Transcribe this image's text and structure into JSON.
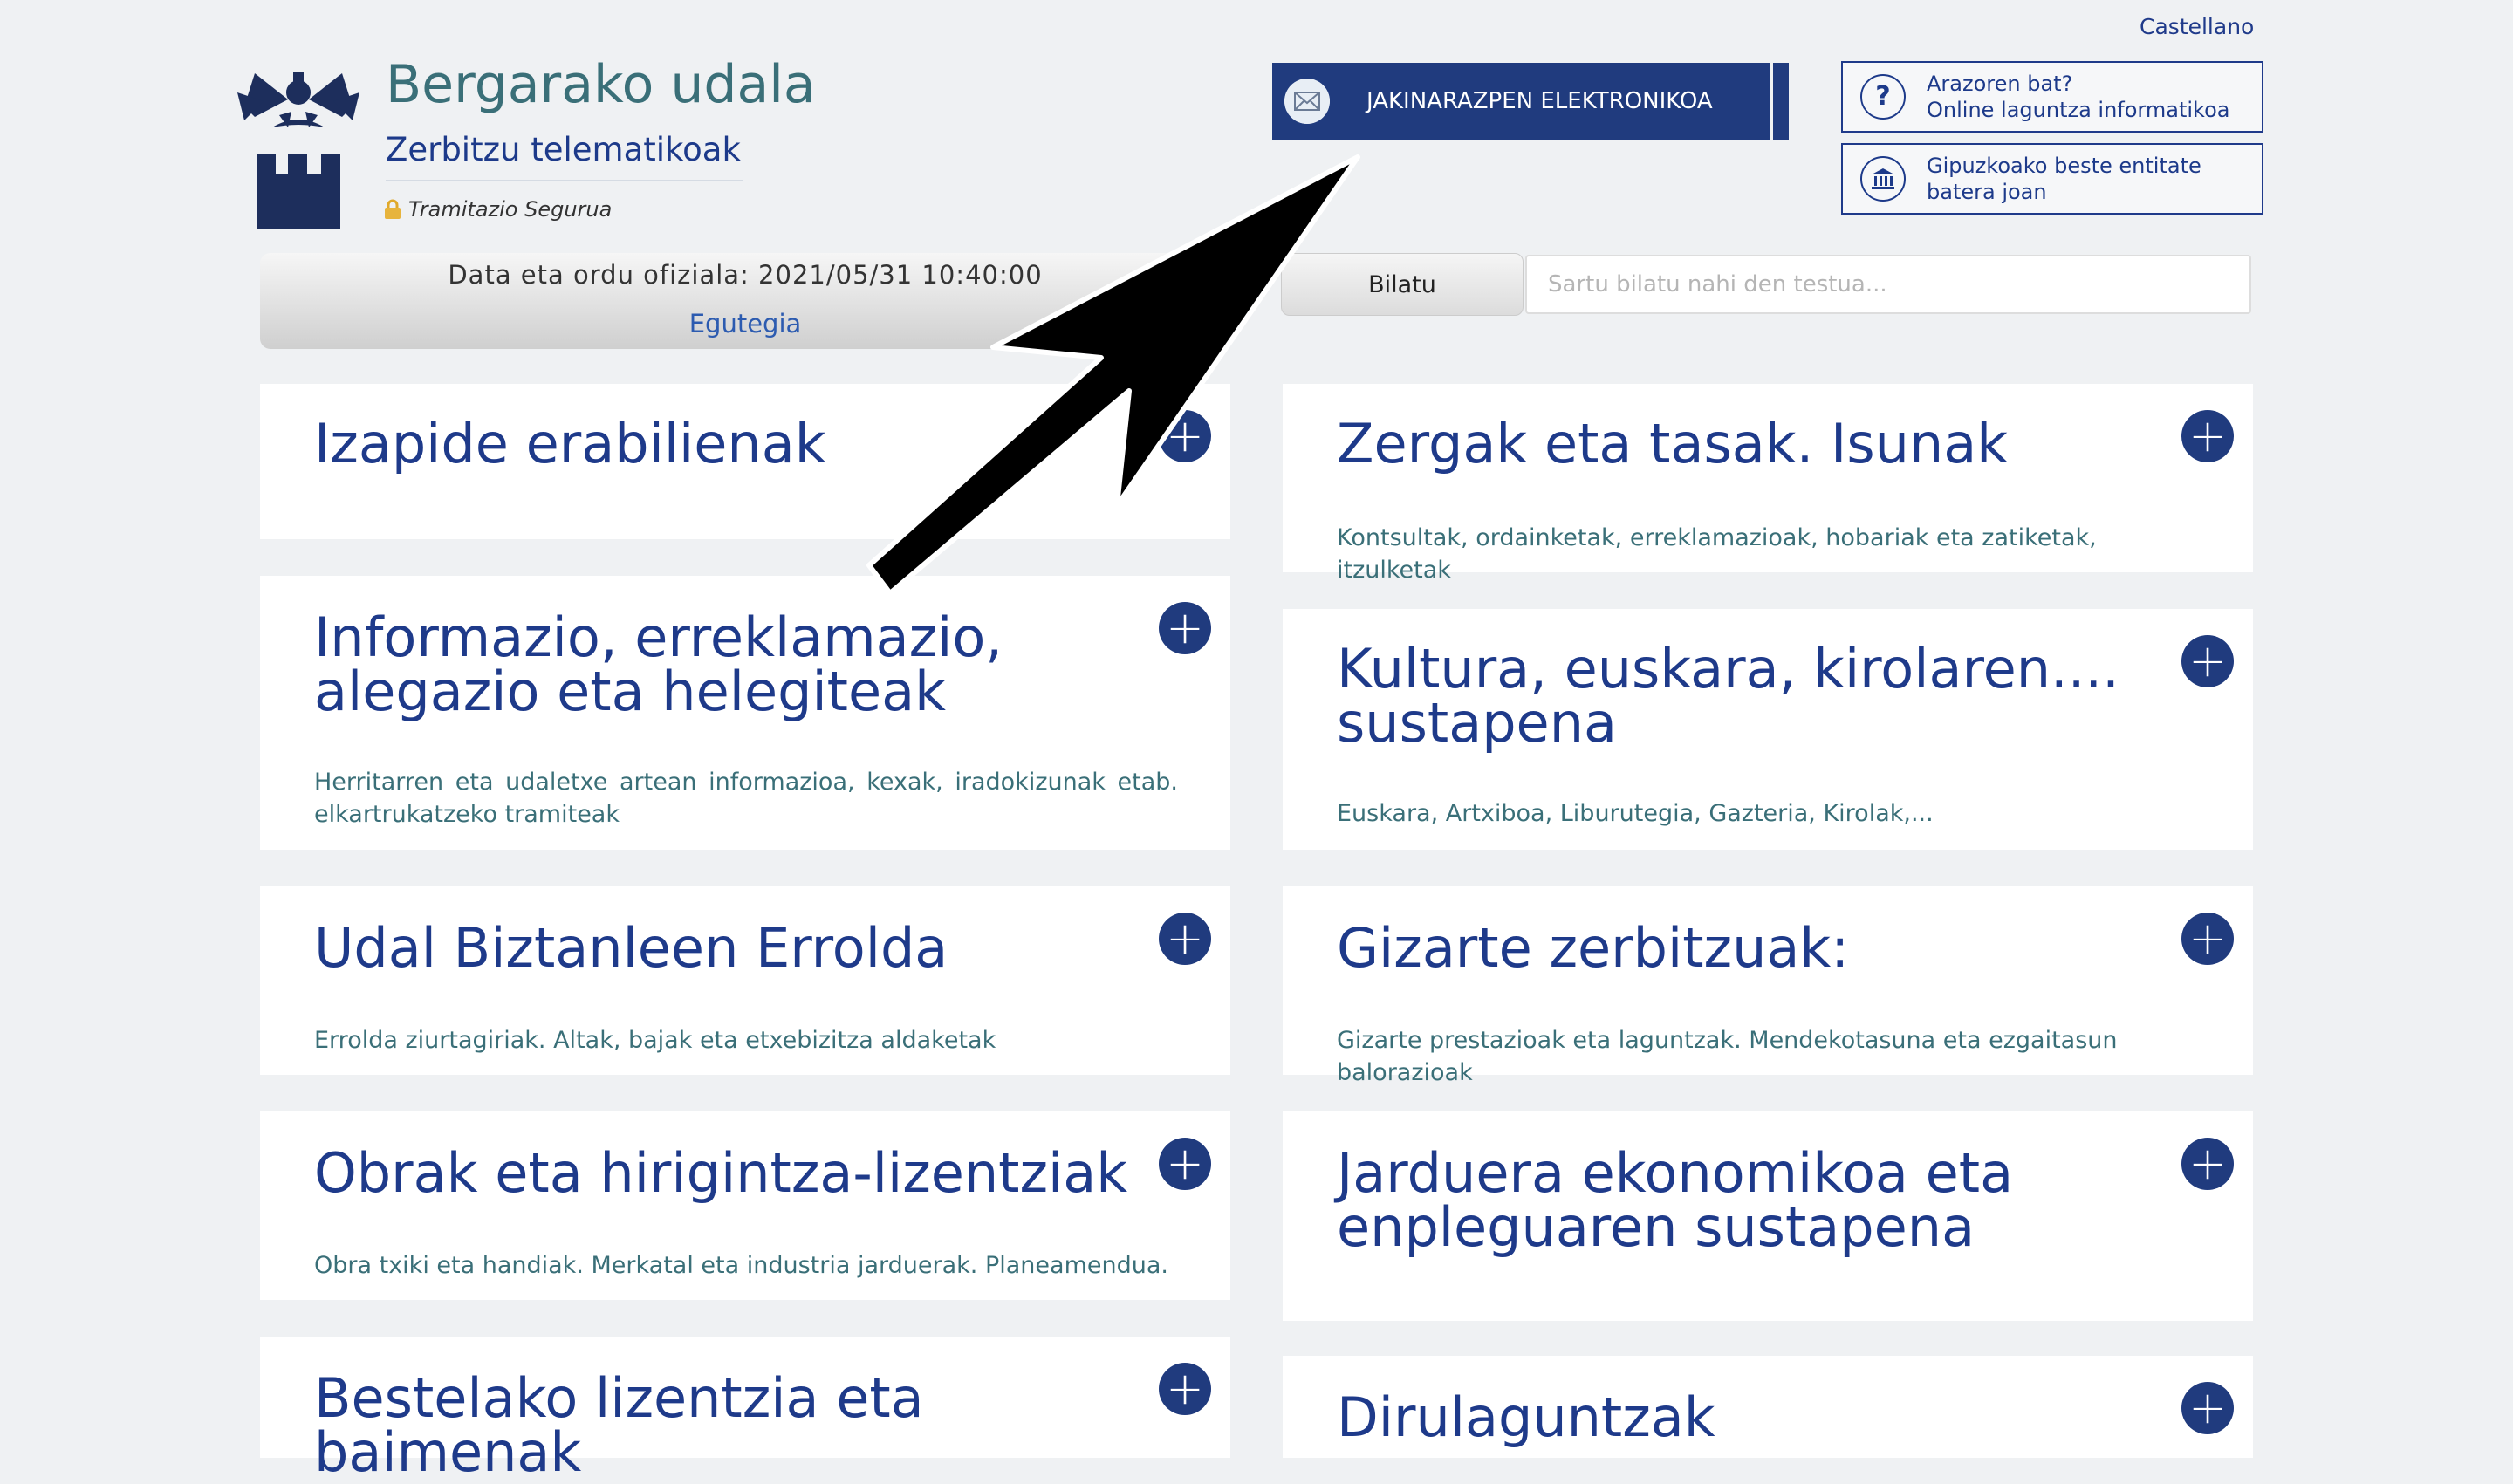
{
  "header": {
    "language_link": "Castellano",
    "org_title": "Bergarako udala",
    "org_subtitle": "Zerbitzu telematikoak",
    "secure_label": "Tramitazio Segurua",
    "enotify_label": "JAKINARAZPEN ELEKTRONIKOA",
    "help": [
      {
        "line1": "Arazoren bat?",
        "line2": "Online laguntza informatikoa",
        "icon": "question-icon"
      },
      {
        "line1": "Gipuzkoako beste entitate",
        "line2": "batera joan",
        "icon": "institution-icon"
      }
    ]
  },
  "datebar": {
    "datetime_label": "Data eta ordu ofiziala: 2021/05/31 10:40:00",
    "calendar_link": "Egutegia"
  },
  "search": {
    "button_label": "Bilatu",
    "placeholder": "Sartu bilatu nahi den testua..."
  },
  "cards": {
    "left": [
      {
        "title": "Izapide erabilienak",
        "desc": ""
      },
      {
        "title": "Informazio, erreklamazio, alegazio eta helegiteak",
        "desc": "Herritarren eta udaletxe artean informazioa, kexak, iradokizunak etab. elkartrukatzeko tramiteak"
      },
      {
        "title": "Udal Biztanleen Errolda",
        "desc": "Errolda ziurtagiriak. Altak, bajak eta etxebizitza aldaketak"
      },
      {
        "title": "Obrak eta hirigintza-lizentziak",
        "desc": "Obra txiki eta handiak. Merkatal eta industria jarduerak. Planeamendua."
      },
      {
        "title": "Bestelako lizentzia eta baimenak",
        "desc": ""
      }
    ],
    "right": [
      {
        "title": "Zergak eta tasak. Isunak",
        "desc": "Kontsultak, ordainketak, erreklamazioak, hobariak eta zatiketak, itzulketak"
      },
      {
        "title": "Kultura, euskara, kirolaren.... sustapena",
        "desc": "Euskara, Artxiboa, Liburutegia, Gazteria, Kirolak,..."
      },
      {
        "title": "Gizarte zerbitzuak:",
        "desc": "Gizarte prestazioak eta laguntzak. Mendekotasuna eta ezgaitasun balorazioak"
      },
      {
        "title": "Jarduera ekonomikoa eta enpleguaren sustapena",
        "desc": ""
      },
      {
        "title": "Dirulaguntzak",
        "desc": ""
      }
    ],
    "plus_symbol": "+"
  },
  "colors": {
    "brand_navy": "#203b7e",
    "title_teal": "#3a6f78",
    "background": "#eff1f3"
  }
}
